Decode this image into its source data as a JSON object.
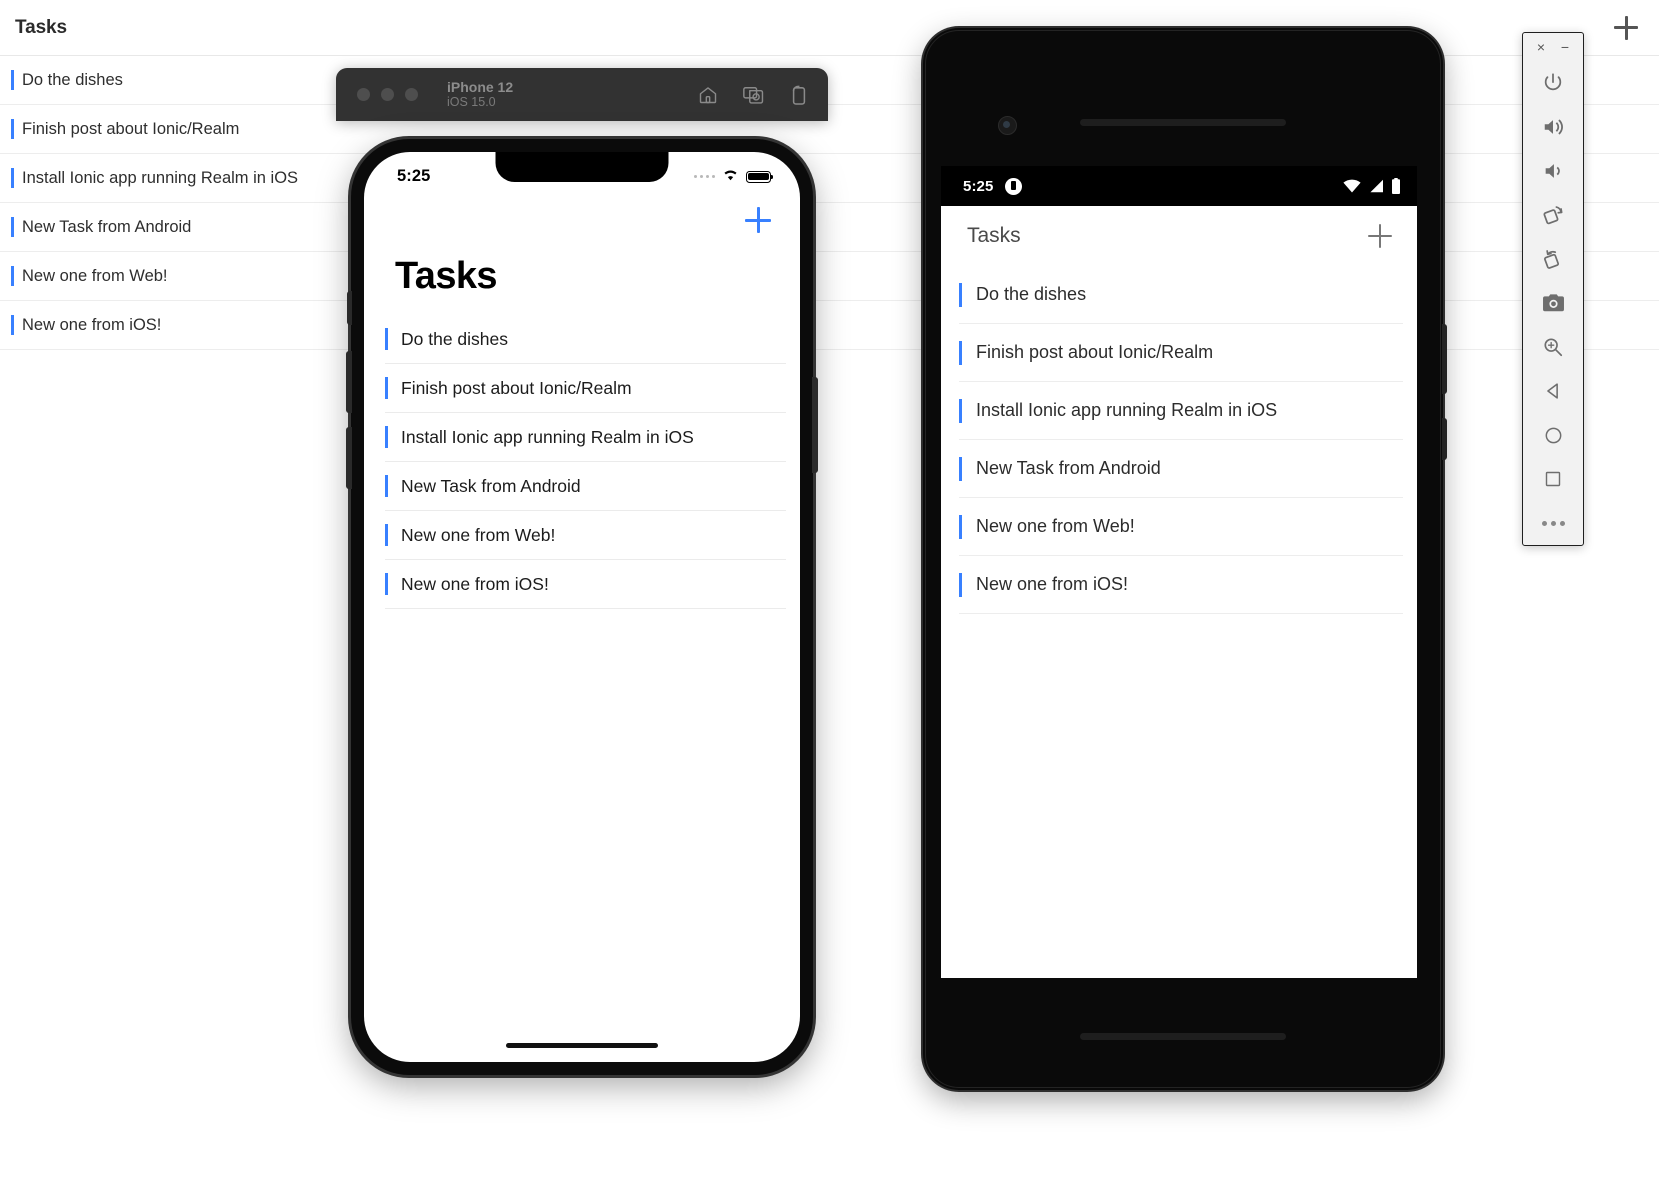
{
  "web": {
    "header_title": "Tasks",
    "add_label": "+",
    "tasks": [
      "Do the dishes",
      "Finish post about Ionic/Realm",
      "Install Ionic app running Realm in iOS",
      "New Task from Android",
      "New one from Web!",
      "New one from iOS!"
    ]
  },
  "ios_simulator": {
    "titlebar": {
      "device_name": "iPhone 12",
      "os_version": "iOS 15.0",
      "icons": [
        "home-icon",
        "screenshot-icon",
        "rotate-icon"
      ]
    },
    "status_bar": {
      "time": "5:25",
      "wifi": "wifi-icon",
      "battery": "battery-icon"
    },
    "app": {
      "title": "Tasks",
      "add_label": "+",
      "tasks": [
        "Do the dishes",
        "Finish post about Ionic/Realm",
        "Install Ionic app running Realm in iOS",
        "New Task from Android",
        "New one from Web!",
        "New one from iOS!"
      ]
    }
  },
  "android_emulator": {
    "status_bar": {
      "time": "5:25",
      "notification": "notification-icon",
      "wifi": "wifi-icon",
      "signal": "cell-signal-icon",
      "battery": "battery-icon"
    },
    "app": {
      "title": "Tasks",
      "add_label": "+",
      "tasks": [
        "Do the dishes",
        "Finish post about Ionic/Realm",
        "Install Ionic app running Realm in iOS",
        "New Task from Android",
        "New one from Web!",
        "New one from iOS!"
      ]
    },
    "toolbar": {
      "close": "×",
      "minimize": "−",
      "buttons": [
        "power-icon",
        "volume-up-icon",
        "volume-down-icon",
        "rotate-left-icon",
        "rotate-right-icon",
        "camera-icon",
        "zoom-icon",
        "back-icon",
        "home-icon",
        "recents-icon",
        "more-icon"
      ]
    }
  },
  "colors": {
    "accent_blue": "#3880ff",
    "web_bg": "#ffffff",
    "sim_titlebar": "#323232",
    "toolbar_bg": "#f2f2f2"
  }
}
